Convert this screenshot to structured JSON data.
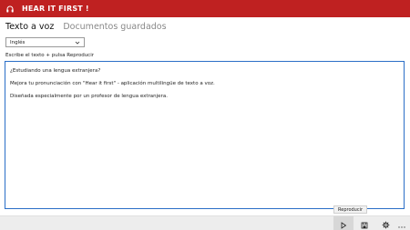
{
  "app": {
    "title": "HEAR IT FIRST !",
    "icon": "headphones-icon",
    "accent_color": "#bf2121"
  },
  "tabs": [
    {
      "label": "Texto a voz",
      "active": true
    },
    {
      "label": "Documentos guardados",
      "active": false
    }
  ],
  "language_select": {
    "selected": "Inglés"
  },
  "hint": "Escribe el texto + pulsa Reproducir",
  "editor": {
    "paragraphs": [
      "¿Estudiando una lengua extranjera?",
      "Mejora tu pronunciación con \"Hear it first\" - aplicación multilingüe de texto a voz.",
      "Diseñada especialmente por un profesor de lengua extranjera."
    ],
    "border_color": "#2a6ec7"
  },
  "command_bar": {
    "buttons": [
      {
        "name": "play",
        "icon": "play-icon"
      },
      {
        "name": "save",
        "icon": "save-icon"
      },
      {
        "name": "settings",
        "icon": "gear-icon"
      },
      {
        "name": "more",
        "icon": "more-icon"
      }
    ],
    "tooltip": "Reproducir"
  }
}
